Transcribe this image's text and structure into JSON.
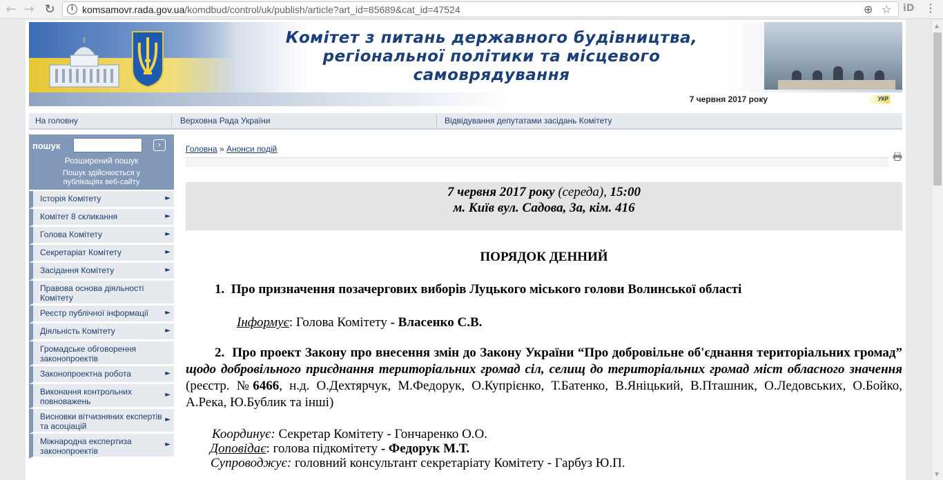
{
  "browser": {
    "url_host": "komsamovr.rada.gov.ua",
    "url_rest": "/komdbud/control/uk/publish/article?art_id=85689&cat_id=47524"
  },
  "header": {
    "title_lines": [
      "Комітет з питань державного будівництва,",
      "регіональної політики та місцевого",
      "самоврядування"
    ],
    "date": "7 червня 2017 року",
    "ukr_badge": "УКР"
  },
  "topnav": [
    "На головну",
    "Верховна Рада України",
    "Відвідування депутатами засідань Комітету"
  ],
  "search": {
    "label": "пошук",
    "value": "",
    "go": "›",
    "advanced": "Розширений пошук",
    "note": "Пошук здійснюється у публікаціях веб-сайту"
  },
  "sidebar": {
    "items": [
      {
        "label": "Історія Комітету"
      },
      {
        "label": "Комітет 8 скликання"
      },
      {
        "label": "Голова Комітету"
      },
      {
        "label": "Секретаріат Комітету"
      },
      {
        "label": "Засідання Комітету"
      },
      {
        "label": "Правова основа діяльності Комітету"
      },
      {
        "label": "Реєстр публічної інформації"
      },
      {
        "label": "Діяльність Комітету"
      },
      {
        "label": "Громадське обговорення законопроектів"
      },
      {
        "label": "Законопроектна робота"
      },
      {
        "label": "Виконання контрольних повноважень"
      },
      {
        "label": "Висновки вітчизняних експертів та асоціацій"
      },
      {
        "label": "Міжнародна експертиза законопроектів"
      }
    ]
  },
  "breadcrumb": {
    "home": "Головна",
    "separator": "»",
    "section": "Анонси подій"
  },
  "meeting": {
    "date": "7 червня 2017 року",
    "weekday": "(середа),",
    "time": "15:00",
    "place": "м. Київ вул. Садова, 3а, кім. 416"
  },
  "agenda": {
    "title": "ПОРЯДОК ДЕННИЙ",
    "item1": {
      "num": "1.",
      "title": "Про призначення позачергових виборів Луцького міського голови Волинської області",
      "informs_label": "Інформує",
      "informs_role": ": Голова Комітету ",
      "informs_name": "- Власенко С.В."
    },
    "item2": {
      "num": "2.",
      "title_bold": "Про проект Закону про внесення змін до Закону України “Про добровільне об'єднання територіальних громад”",
      "title_italic": " щодо добровільного приєднання територіальних громад сіл, селищ до територіальних громад міст обласного значення",
      "reg_open": " (реєстр. №",
      "reg_no": "6466",
      "authors": ", н.д. О.Дехтярчук, М.Федорук, О.Купрієнко, Т.Батенко, В.Яніцький, В.Пташник, О.Ледовських, О.Бойко, А.Река, Ю.Бублик та інші)",
      "coord_label": "Координує:",
      "coord_text": " Секретар Комітету - Гончаренко О.О.",
      "report_label": "Доповідає",
      "report_text": ": голова підкомітету  ",
      "report_name": "- Федорук М.Т.",
      "accomp_label": "Супроводжує:",
      "accomp_text": " головний консультант секретаріату Комітету -  Гарбуз Ю.П."
    }
  },
  "colors": {
    "nav_text": "#1b3e6f",
    "sidebar_accent": "#8298b8",
    "banner_title": "#1b3f78"
  }
}
